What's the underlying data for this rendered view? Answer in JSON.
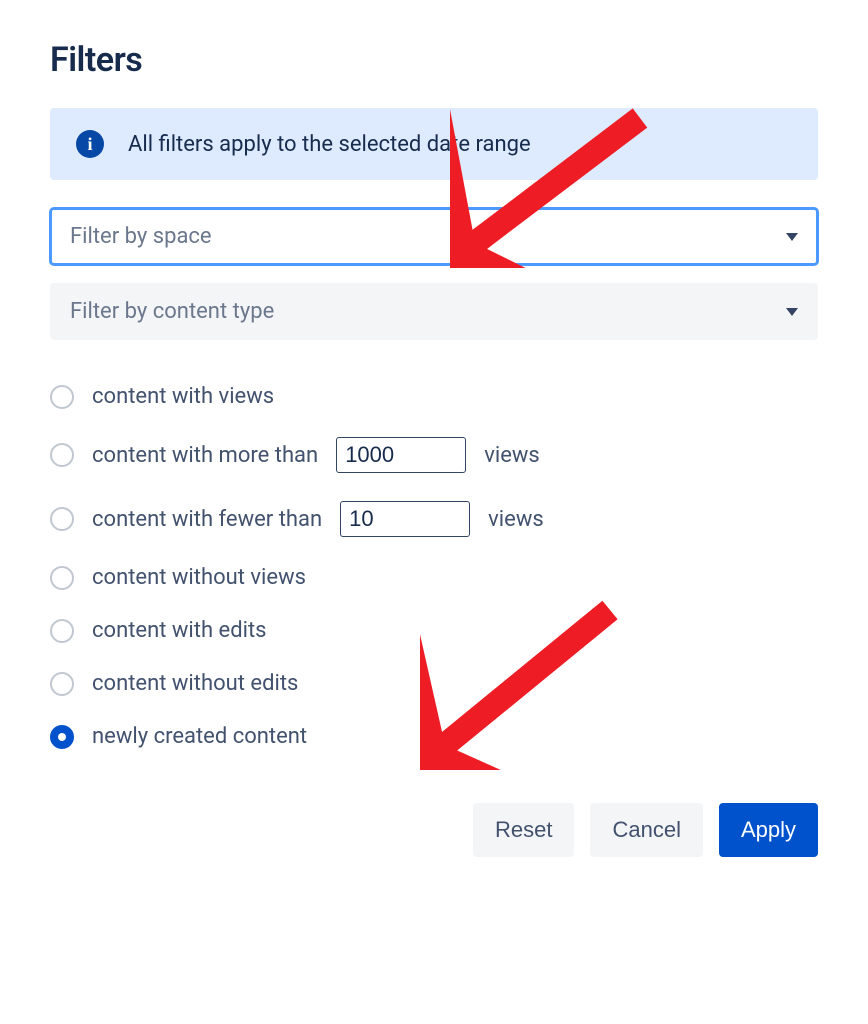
{
  "title": "Filters",
  "info_banner": "All filters apply to the selected date range",
  "dropdowns": {
    "space": "Filter by space",
    "content_type": "Filter by content type"
  },
  "radios": {
    "with_views": "content with views",
    "more_than_pre": "content with more than",
    "more_than_val": "1000",
    "more_than_post": "views",
    "fewer_than_pre": "content with fewer than",
    "fewer_than_val": "10",
    "fewer_than_post": "views",
    "without_views": "content without views",
    "with_edits": "content with edits",
    "without_edits": "content without edits",
    "newly_created": "newly created content",
    "selected": "newly_created"
  },
  "buttons": {
    "reset": "Reset",
    "cancel": "Cancel",
    "apply": "Apply"
  }
}
